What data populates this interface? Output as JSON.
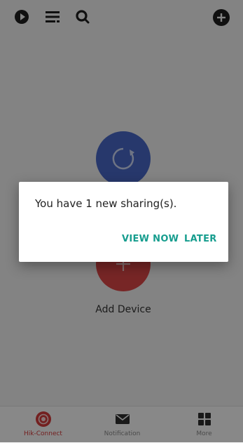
{
  "toolbar": {
    "icons": [
      "play-icon",
      "list-icon",
      "search-icon",
      "add-icon"
    ]
  },
  "main": {
    "add_device_label": "Add Device"
  },
  "bottom_nav": {
    "items": [
      {
        "label": "Hik-Connect",
        "icon": "hik-connect-icon",
        "active": true
      },
      {
        "label": "Notification",
        "icon": "mail-icon",
        "active": false
      },
      {
        "label": "More",
        "icon": "grid-icon",
        "active": false
      }
    ]
  },
  "dialog": {
    "message": "You have 1 new sharing(s).",
    "primary_label": "VIEW NOW",
    "secondary_label": "LATER"
  },
  "colors": {
    "accent_teal": "#169d8e",
    "brand_red": "#d23b3b",
    "refresh_blue": "#4767c5"
  }
}
